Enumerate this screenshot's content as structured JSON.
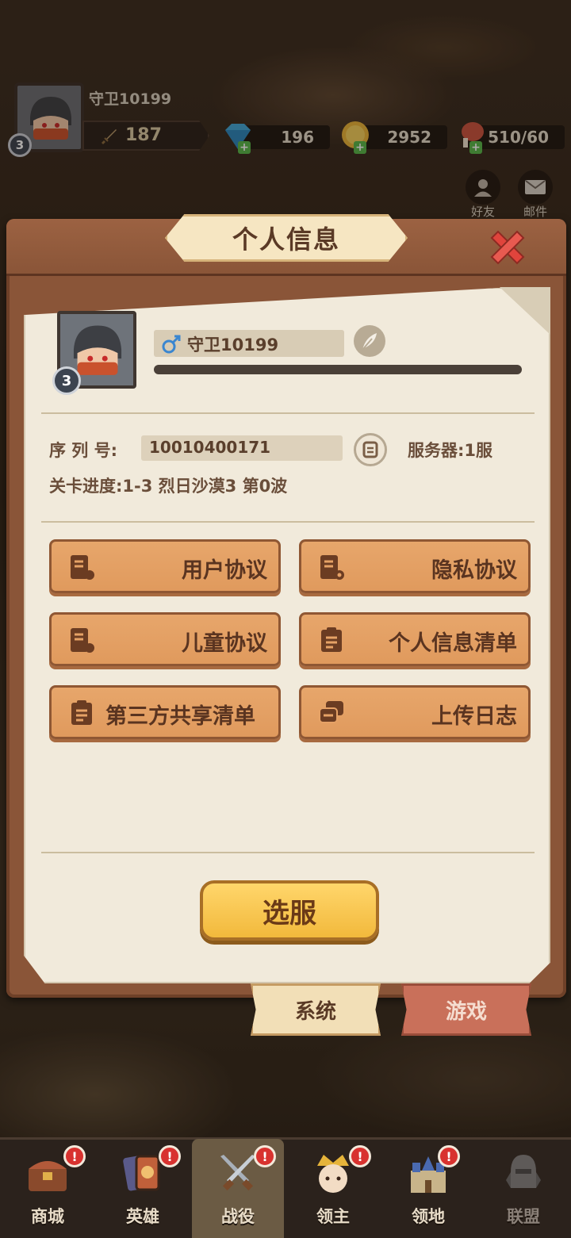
{
  "hud": {
    "player_name": "守卫10199",
    "level": "3",
    "power": "187",
    "gems": "196",
    "gold": "2952",
    "stamina": "510/60",
    "friends_label": "好友",
    "mail_label": "邮件"
  },
  "panel": {
    "title": "个人信息",
    "name": "守卫10199",
    "level": "3",
    "serial_label": "序 列 号:",
    "serial_value": "10010400171",
    "server_text": "服务器:1服",
    "progress_text": "关卡进度:1-3 烈日沙漠3 第0波",
    "buttons": {
      "user_agreement": "用户协议",
      "privacy_agreement": "隐私协议",
      "child_agreement": "儿童协议",
      "personal_info_list": "个人信息清单",
      "third_party_list": "第三方共享清单",
      "upload_log": "上传日志"
    },
    "select_server": "选服",
    "tabs": {
      "system": "系统",
      "game": "游戏"
    }
  },
  "nav": {
    "items": [
      {
        "label": "商城",
        "badge": "!"
      },
      {
        "label": "英雄",
        "badge": "!"
      },
      {
        "label": "战役",
        "badge": "!"
      },
      {
        "label": "领主",
        "badge": "!"
      },
      {
        "label": "领地",
        "badge": "!"
      },
      {
        "label": "联盟",
        "badge": ""
      }
    ]
  },
  "colors": {
    "panel_wood": "#8a5538",
    "paper": "#f1eadb",
    "doc_button": "#e09a5d",
    "select_button": "#f2b93c",
    "badge": "#d8322f"
  }
}
